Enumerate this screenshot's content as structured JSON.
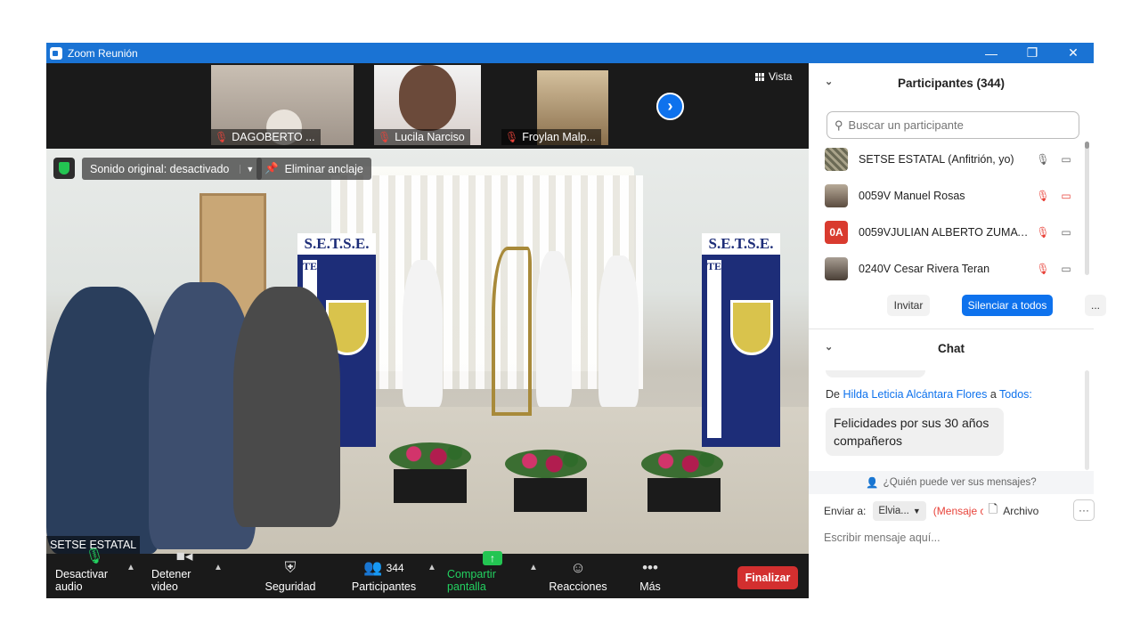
{
  "window": {
    "title": "Zoom Reunión",
    "minimize": "—",
    "restore": "❐",
    "close": "✕"
  },
  "thumbnails": [
    {
      "name": "DAGOBERTO ...",
      "muted": true
    },
    {
      "name": "Lucila Narciso",
      "muted": true
    },
    {
      "name": "Froylan Malp...",
      "muted": true
    }
  ],
  "next_arrow": "›",
  "view_button": "Vista",
  "main_video": {
    "original_sound": "Sonido original: desactivado",
    "unpin": "Eliminar anclaje",
    "speaker": "SETSE ESTATAL",
    "banner_text": "S.E.T.S.E.",
    "banner_vertical": "TELEBACHILLERATO"
  },
  "toolbar": {
    "mute": "Desactivar audio",
    "video": "Detener video",
    "security": "Seguridad",
    "participants": "Participantes",
    "participants_count": "344",
    "share": "Compartir pantalla",
    "reactions": "Reacciones",
    "more": "Más",
    "end": "Finalizar"
  },
  "participants_panel": {
    "title": "Participantes (344)",
    "search_placeholder": "Buscar un participante",
    "list": [
      {
        "name": "SETSE ESTATAL (Anfitrión, yo)",
        "mic": "on",
        "video": "on"
      },
      {
        "name": "0059V Manuel Rosas",
        "mic": "muted",
        "video": "off"
      },
      {
        "name": "0059VJULIAN ALBERTO ZUMAYA...",
        "initials": "0A",
        "mic": "muted",
        "video": "on"
      },
      {
        "name": "0240V Cesar Rivera Teran",
        "mic": "muted",
        "video": "on"
      }
    ],
    "invite": "Invitar",
    "mute_all": "Silenciar a todos",
    "more": "..."
  },
  "chat_panel": {
    "title": "Chat",
    "from_prefix": "De",
    "from_name": "Hilda Leticia Alcántara Flores",
    "to_word": "a",
    "to_target": "Todos:",
    "message": "Felicidades por sus 30 años compañeros",
    "who_can_see": "¿Quién puede ver sus mensajes?",
    "send_to_label": "Enviar a:",
    "send_to_value": "Elvia...",
    "private_note": "(Mensaje c",
    "file_label": "Archivo",
    "more": "···",
    "input_placeholder": "Escribir mensaje aquí..."
  },
  "colors": {
    "accent": "#0e72ed",
    "titlebar": "#1a73d4",
    "end": "#d32f2f",
    "muted": "#e8433a",
    "share": "#23c552"
  }
}
